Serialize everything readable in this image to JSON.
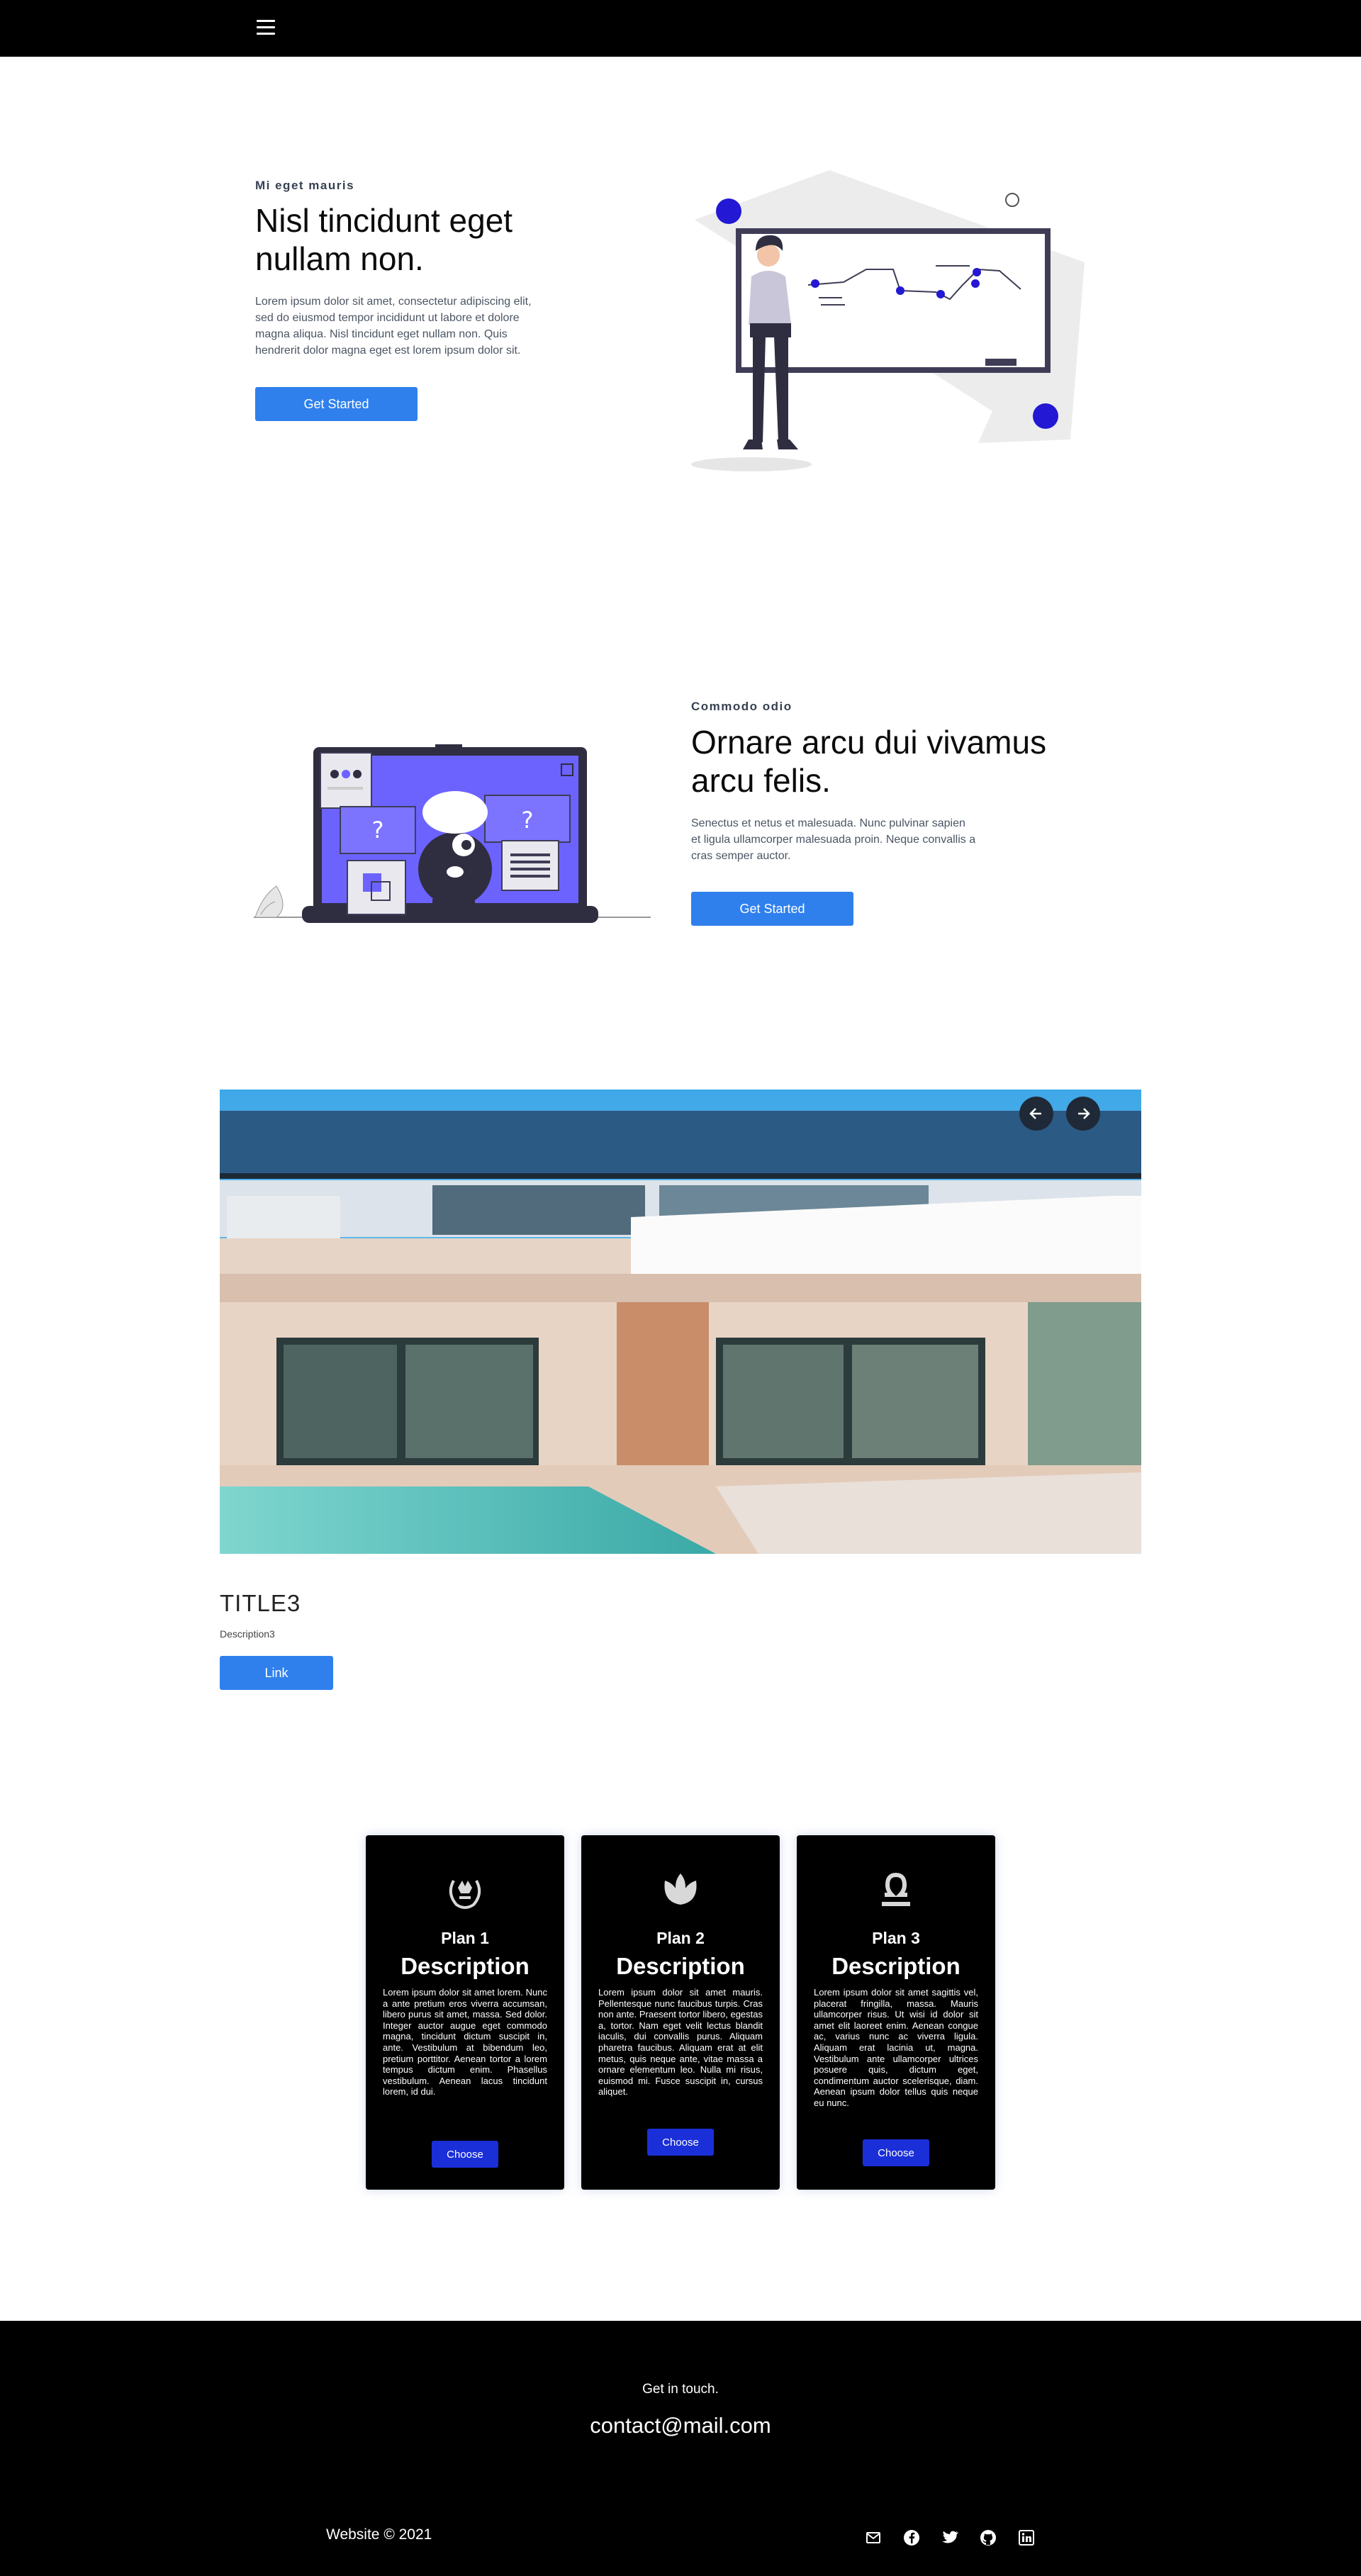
{
  "nav": {
    "menu_icon": "hamburger-menu-icon"
  },
  "hero": {
    "eyebrow": "Mi eget mauris",
    "title_line1": "Nisl tincidunt eget",
    "title_line2": "nullam non.",
    "text_lines": [
      "Lorem ipsum dolor sit amet, consectetur adipiscing elit,",
      "sed do eiusmod tempor incididunt ut labore et dolore",
      "magna aliqua. Nisl tincidunt eget nullam non. Quis",
      "hendrerit dolor magna eget est lorem ipsum dolor sit."
    ],
    "button": "Get Started"
  },
  "feature": {
    "eyebrow": "Commodo odio",
    "title_line1": "Ornare arcu dui vivamus",
    "title_line2": "arcu felis.",
    "text_lines": [
      "Senectus et netus et malesuada. Nunc pulvinar sapien",
      "et ligula ullamcorper malesuada proin. Neque convallis a",
      "cras semper auctor."
    ],
    "button": "Get Started"
  },
  "slider": {
    "prev_icon": "arrow-left-icon",
    "next_icon": "arrow-right-icon",
    "title": "TITLE3",
    "description": "Description3",
    "link": "Link"
  },
  "plans": [
    {
      "icon": "laurel-crown-icon",
      "name": "Plan 1",
      "heading": "Description",
      "text": "Lorem ipsum dolor sit amet lorem. Nunc a ante pretium eros viverra accumsan, libero purus sit amet, massa. Sed dolor. Integer auctor augue eget commodo magna, tincidunt dictum suscipit in, ante. Vestibulum at bibendum leo, pretium porttitor. Aenean tortor a lorem tempus dictum enim. Phasellus vestibulum. Aenean lacus tincidunt lorem, id dui.",
      "button": "Choose"
    },
    {
      "icon": "lotus-icon",
      "name": "Plan 2",
      "heading": "Description",
      "text": "Lorem ipsum dolor sit amet mauris. Pellentesque nunc faucibus turpis. Cras non ante. Praesent tortor libero, egestas a, tortor. Nam eget velit lectus blandit iaculis, dui convallis purus. Aliquam pharetra faucibus. Aliquam erat at elit metus, quis neque ante, vitae massa a ornare elementum leo. Nulla mi risus, euismod mi. Fusce suscipit in, cursus aliquet.",
      "button": "Choose"
    },
    {
      "icon": "libra-icon",
      "name": "Plan 3",
      "heading": "Description",
      "text": "Lorem ipsum dolor sit amet sagittis vel, placerat fringilla, massa. Mauris ullamcorper risus. Ut wisi id dolor sit amet elit laoreet enim. Aenean congue ac, varius nunc ac viverra ligula. Aliquam erat lacinia ut, magna. Vestibulum ante ullamcorper ultrices posuere quis, dictum eget, condimentum auctor scelerisque, diam. Aenean ipsum dolor tellus quis neque eu nunc.",
      "button": "Choose"
    }
  ],
  "footer": {
    "tagline": "Get in touch.",
    "email": "contact@mail.com",
    "copyright": "Website © 2021",
    "social_icons": [
      "mail-icon",
      "facebook-icon",
      "twitter-icon",
      "github-icon",
      "linkedin-icon"
    ]
  },
  "colors": {
    "accent": "#2f80ed",
    "indigo": "#1a2fd8",
    "illustration_purple": "#6c63ff"
  }
}
